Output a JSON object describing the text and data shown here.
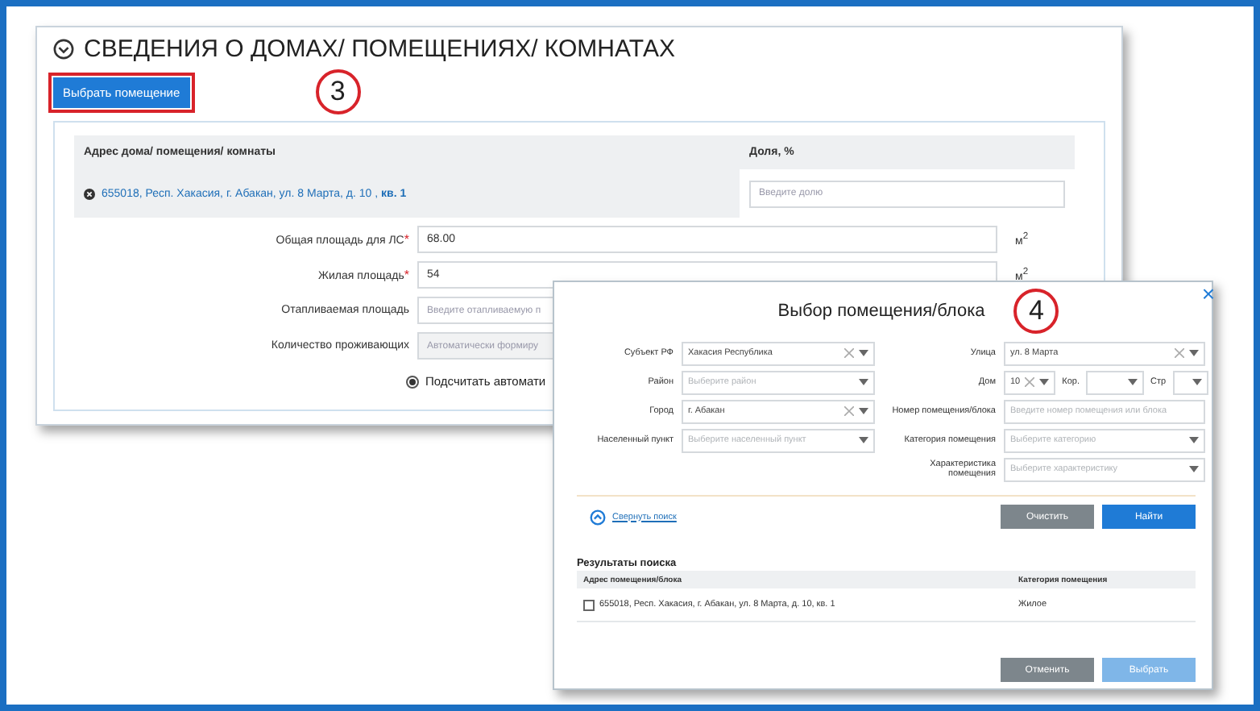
{
  "section": {
    "title": "СВЕДЕНИЯ О ДОМАХ/ ПОМЕЩЕНИЯХ/ КОМНАТАХ",
    "select_button": "Выбрать помещение",
    "step": "3",
    "table": {
      "columns": [
        "Адрес дома/ помещения/ комнаты",
        "Доля, %"
      ],
      "address": "655018, Респ. Хакасия, г. Абакан, ул. 8 Марта, д. 10 , **кв. 1**",
      "share_placeholder": "Введите долю"
    },
    "fields": [
      {
        "label": "Общая площадь для ЛС",
        "required_mark": "*",
        "value": "68.00",
        "unit": "м$^{2}$",
        "disabled": false
      },
      {
        "label": "Жилая площадь",
        "required_mark": "*",
        "value": "54",
        "unit": "м$^{2}$",
        "disabled": false
      },
      {
        "label": "Отапливаемая площадь",
        "placeholder": "Введите отапливаемую п",
        "disabled": false
      },
      {
        "label": "Количество проживающих",
        "placeholder": "Автоматически формиру",
        "disabled": true
      }
    ],
    "auto_option": {
      "label": "Подсчитать автомати",
      "selected": true
    }
  },
  "dialog": {
    "title": "Выбор помещения/блока",
    "step": "4",
    "close": "×",
    "left_fields": [
      {
        "label": "Субъект РФ",
        "value": "Хакасия Республика",
        "clearable": true
      },
      {
        "label": "Район",
        "placeholder": "Выберите район",
        "clearable": false
      },
      {
        "label": "Город",
        "value": "г. Абакан",
        "clearable": true
      },
      {
        "label": "Населенный пункт",
        "placeholder": "Выберите населенный пункт",
        "clearable": false
      }
    ],
    "right_fields": [
      {
        "label": "Улица",
        "kind": "select",
        "value": "ул. 8 Марта",
        "clearable": true
      },
      {
        "label": "Дом",
        "kind": "house",
        "value": "10",
        "clearable": true,
        "building_label": "Кор.",
        "structure_label": "Стр"
      },
      {
        "label": "Номер помещения/блока",
        "kind": "input",
        "placeholder": "Введите номер помещения или блока"
      },
      {
        "label": "Категория помещения",
        "kind": "select",
        "placeholder": "Выберите категорию",
        "clearable": false
      },
      {
        "label": "Характеристика помещения",
        "kind": "select",
        "placeholder": "Выберите характеристику",
        "clearable": false
      }
    ],
    "collapse_link": "Свернуть поиск",
    "clear_button": "Очистить",
    "find_button": "Найти",
    "results_title": "Результаты поиска",
    "results_columns": [
      "Адрес помещения/блока",
      "Категория помещения"
    ],
    "results": [
      {
        "address": "655018, Респ. Хакасия, г. Абакан, ул. 8 Марта, д. 10, кв. 1",
        "category": "Жилое",
        "checked": false
      }
    ],
    "cancel_button": "Отменить",
    "choose_button": {
      "label": "Выбрать",
      "disabled": true
    }
  }
}
